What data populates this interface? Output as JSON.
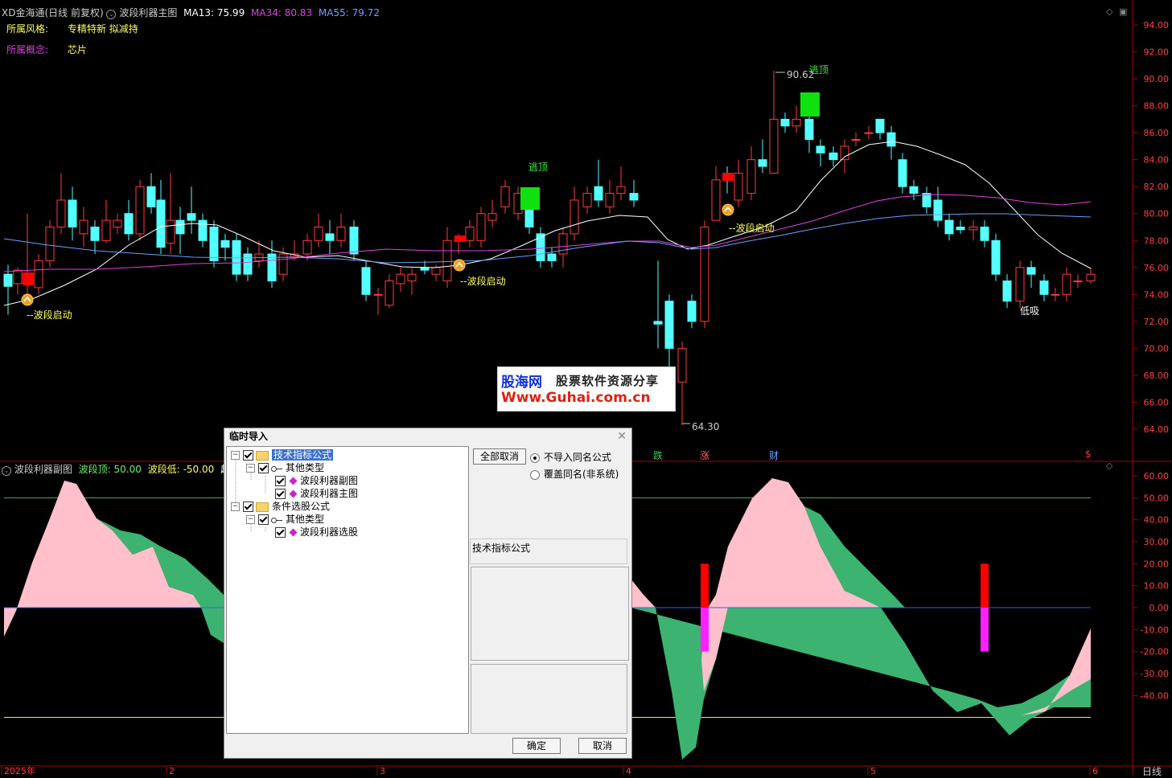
{
  "header": {
    "app": "XD金海通",
    "period": "(日线 前复权)",
    "indicator": "波段利器主图",
    "ma13": "MA13: 75.99",
    "ma34": "MA34: 80.83",
    "ma55": "MA55: 79.72",
    "style_label": "所属风格:",
    "style_value": "专精特新 拟减持",
    "concept_label": "所属概念:",
    "concept_value": "芯片"
  },
  "sub_header": {
    "name": "波段利器副图",
    "top": "波段顶: 50.00",
    "low": "波段低: -50.00",
    "trend": "趋势"
  },
  "price_axis": [
    "94.00",
    "92.00",
    "90.00",
    "88.00",
    "86.00",
    "84.00",
    "82.00",
    "80.00",
    "78.00",
    "76.00",
    "74.00",
    "72.00",
    "70.00",
    "68.00",
    "66.00",
    "64.00"
  ],
  "osc_axis": [
    "60.00",
    "50.00",
    "40.00",
    "30.00",
    "20.00",
    "10.00",
    "0.00",
    "-10.00",
    "-20.00",
    "-30.00",
    "-40.00"
  ],
  "x_axis": [
    "2025年",
    "2",
    "3",
    "4",
    "5",
    "6"
  ],
  "period_button": "日线",
  "annotations": {
    "high": "90.62",
    "low": "64.30",
    "escape1": "逃顶",
    "escape2": "逃顶",
    "start1": "--波段启动",
    "start2": "--波段启动",
    "start3": "--波段启动",
    "dip": "低吸",
    "fall": "跌",
    "rise": "涨",
    "fin": "财",
    "dollar": "$"
  },
  "watermark": {
    "brand": "股海网",
    "slogan": "股票软件资源分享",
    "url": "Www.Guhai.com.cn"
  },
  "dialog": {
    "title": "临时导入",
    "tree": [
      {
        "label": "技术指标公式",
        "level": 0
      },
      {
        "label": "其他类型",
        "level": 1
      },
      {
        "label": "波段利器副图",
        "level": 2
      },
      {
        "label": "波段利器主图",
        "level": 2
      },
      {
        "label": "条件选股公式",
        "level": 0
      },
      {
        "label": "其他类型",
        "level": 1
      },
      {
        "label": "波段利器选股",
        "level": 2
      }
    ],
    "cancel_all": "全部取消",
    "radio1": "不导入同名公式",
    "radio2": "覆盖同名(非系统)",
    "info": "技术指标公式",
    "ok": "确定",
    "cancel": "取消"
  },
  "colors": {
    "up": "#ff3b3b",
    "down": "#54ffff",
    "ma13": "#ffffff",
    "ma34": "#e040e0",
    "ma55": "#6aa0ff",
    "osc_pink": "#ffc0cb",
    "osc_green": "#3cb371",
    "grid": "#8b0000"
  }
}
